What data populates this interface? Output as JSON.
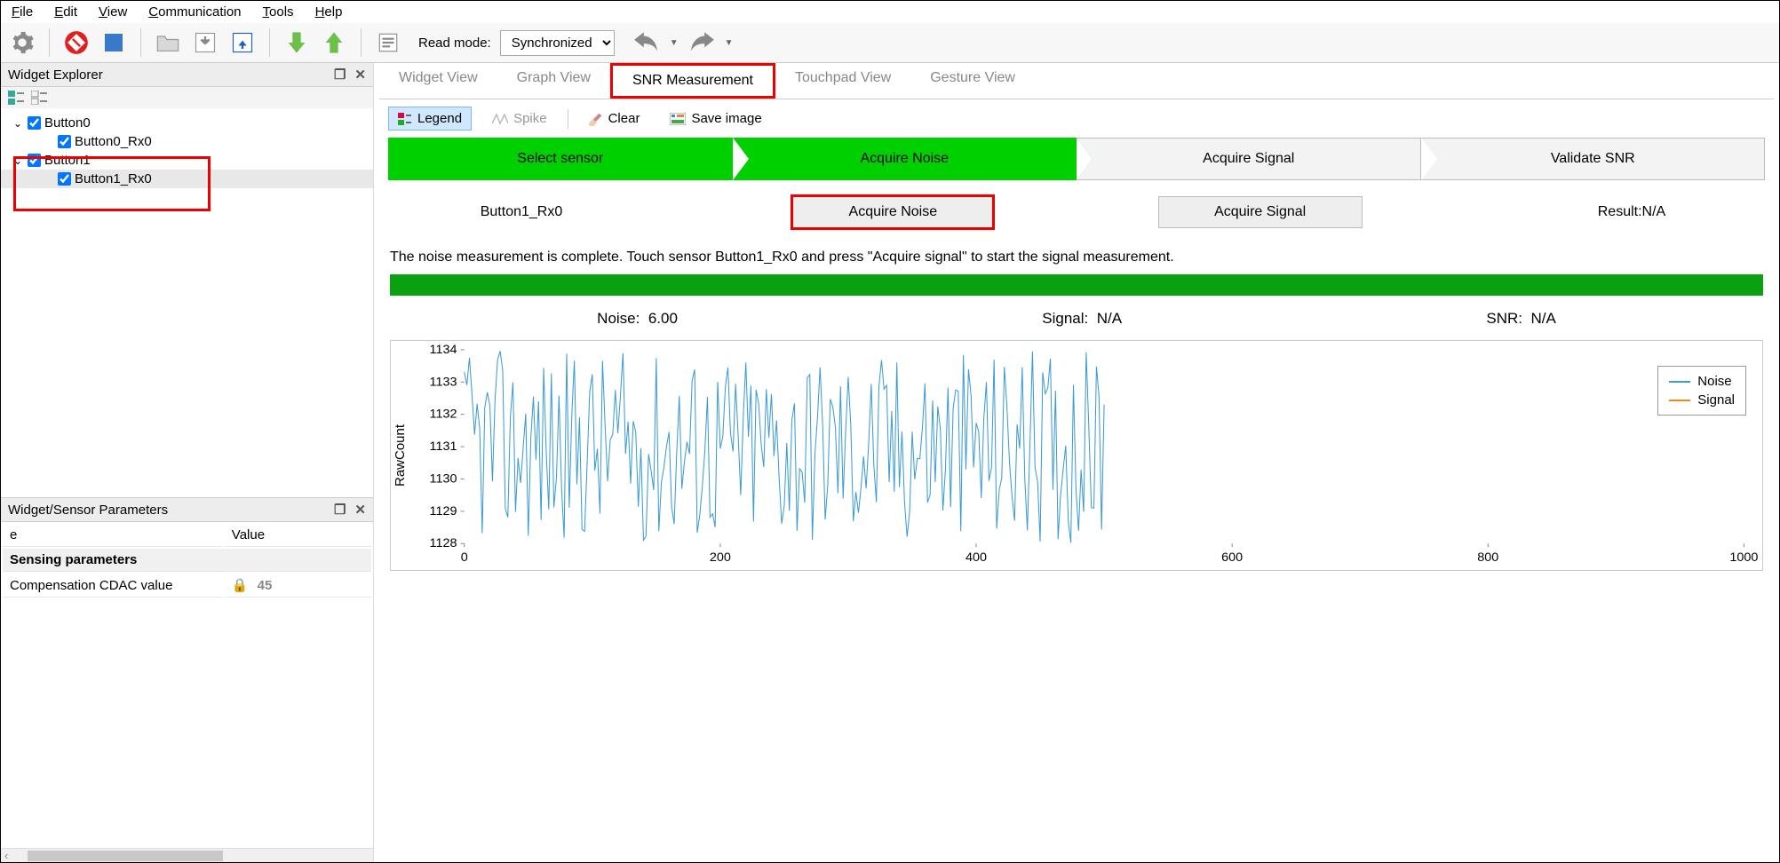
{
  "menu": {
    "file": "File",
    "edit": "Edit",
    "view": "View",
    "communication": "Communication",
    "tools": "Tools",
    "help": "Help"
  },
  "toolbar": {
    "read_mode_label": "Read mode:",
    "read_mode_value": "Synchronized"
  },
  "left": {
    "explorer_title": "Widget Explorer",
    "params_title": "Widget/Sensor Parameters",
    "tree": {
      "button0": "Button0",
      "button0_rx0": "Button0_Rx0",
      "button1": "Button1",
      "button1_rx0": "Button1_Rx0"
    },
    "table": {
      "col_name": "e",
      "col_value": "Value",
      "group": "Sensing parameters",
      "param_name": "Compensation CDAC value",
      "param_value": "45"
    }
  },
  "tabs": {
    "widget_view": "Widget View",
    "graph_view": "Graph View",
    "snr": "SNR Measurement",
    "touchpad": "Touchpad View",
    "gesture": "Gesture View"
  },
  "content_toolbar": {
    "legend": "Legend",
    "spike": "Spike",
    "clear": "Clear",
    "save_image": "Save image"
  },
  "steps": {
    "s1": "Select sensor",
    "s2": "Acquire Noise",
    "s3": "Acquire Signal",
    "s4": "Validate SNR"
  },
  "actions": {
    "sensor": "Button1_Rx0",
    "acquire_noise": "Acquire Noise",
    "acquire_signal": "Acquire Signal",
    "result_label": "Result:",
    "result_value": "N/A"
  },
  "status": "The noise measurement is complete. Touch sensor Button1_Rx0 and press \"Acquire signal\" to start the signal measurement.",
  "metrics": {
    "noise_label": "Noise:",
    "noise_value": "6.00",
    "signal_label": "Signal:",
    "signal_value": "N/A",
    "snr_label": "SNR:",
    "snr_value": "N/A"
  },
  "chart_data": {
    "type": "line",
    "ylabel": "RawCount",
    "xlabel": "",
    "xlim": [
      0,
      1000
    ],
    "ylim": [
      1128,
      1134
    ],
    "x_ticks": [
      0,
      200,
      400,
      600,
      800,
      1000
    ],
    "y_ticks": [
      1128,
      1129,
      1130,
      1131,
      1132,
      1133,
      1134
    ],
    "series": [
      {
        "name": "Noise",
        "color": "#3b9ad8",
        "x_range": [
          0,
          500
        ],
        "mean": 1131,
        "min": 1128,
        "max": 1134
      },
      {
        "name": "Signal",
        "color": "#e88b1a",
        "x_range": [
          0,
          0
        ]
      }
    ],
    "legend": [
      "Noise",
      "Signal"
    ]
  }
}
